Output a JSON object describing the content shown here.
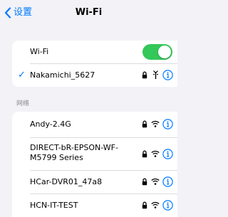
{
  "nav": {
    "back_label": "设置",
    "title": "Wi-Fi"
  },
  "wifi_toggle": {
    "label": "Wi-Fi",
    "on": true
  },
  "connected": {
    "name": "Nakamichi_5627",
    "icons": [
      "lock-icon",
      "signal-icon",
      "info-icon"
    ]
  },
  "section_label": "网络",
  "networks": [
    {
      "name": "Andy-2.4G",
      "icons": [
        "lock-icon",
        "wifi-icon",
        "info-icon"
      ]
    },
    {
      "name": "DIRECT-bR-EPSON-WF-",
      "name_line2": "M5799 Series",
      "icons": [
        "lock-icon",
        "wifi-icon",
        "info-icon"
      ]
    },
    {
      "name": "HCar-DVR01_47a8",
      "icons": [
        "lock-icon",
        "wifi-icon",
        "info-icon"
      ]
    },
    {
      "name": "HCN-IT-TEST",
      "icons": [
        "lock-icon",
        "wifi-icon",
        "info-icon"
      ]
    }
  ],
  "colors": {
    "accent": "#007aff",
    "toggle_on": "#34c759",
    "background": "#f2f2f7"
  }
}
